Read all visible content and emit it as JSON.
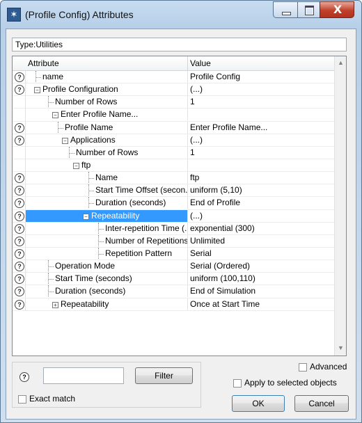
{
  "window": {
    "title": "(Profile Config) Attributes",
    "close_glyph": "X"
  },
  "type_field": {
    "label": "Type:",
    "value": "Utilities"
  },
  "grid": {
    "col_attribute": "Attribute",
    "col_value": "Value",
    "rows": [
      {
        "q": true,
        "label": "name",
        "value": "Profile Config"
      },
      {
        "q": true,
        "label": "Profile Configuration",
        "value": "(...)"
      },
      {
        "q": false,
        "label": "Number of Rows",
        "value": "1"
      },
      {
        "q": false,
        "label": "Enter Profile Name...",
        "value": ""
      },
      {
        "q": true,
        "label": "Profile Name",
        "value": "Enter Profile Name..."
      },
      {
        "q": true,
        "label": "Applications",
        "value": "(...)"
      },
      {
        "q": false,
        "label": "Number of Rows",
        "value": "1"
      },
      {
        "q": false,
        "label": "ftp",
        "value": ""
      },
      {
        "q": true,
        "label": "Name",
        "value": "ftp"
      },
      {
        "q": true,
        "label": "Start Time Offset (secon...",
        "value": "uniform (5,10)"
      },
      {
        "q": true,
        "label": "Duration (seconds)",
        "value": "End of Profile"
      },
      {
        "q": true,
        "label": "Repeatability",
        "value": "(...)"
      },
      {
        "q": true,
        "label": "Inter-repetition Time (...",
        "value": "exponential (300)"
      },
      {
        "q": true,
        "label": "Number of Repetitions",
        "value": "Unlimited"
      },
      {
        "q": true,
        "label": "Repetition Pattern",
        "value": "Serial"
      },
      {
        "q": true,
        "label": "Operation Mode",
        "value": "Serial (Ordered)"
      },
      {
        "q": true,
        "label": "Start Time (seconds)",
        "value": "uniform (100,110)"
      },
      {
        "q": true,
        "label": "Duration (seconds)",
        "value": "End of Simulation"
      },
      {
        "q": true,
        "label": "Repeatability",
        "value": "Once at Start Time"
      }
    ]
  },
  "filter": {
    "button_label": "Filter",
    "exact_match_label": "Exact match",
    "input_value": ""
  },
  "options": {
    "advanced_label": "Advanced",
    "apply_selected_label": "Apply to selected objects"
  },
  "buttons": {
    "ok_label": "OK",
    "cancel_label": "Cancel"
  },
  "colors": {
    "selection": "#3399ff",
    "close_button": "#c0402a",
    "frame": "#b7cfe8"
  },
  "icons": {
    "help": "?",
    "expand": "⊞",
    "collapse": "⊟"
  }
}
